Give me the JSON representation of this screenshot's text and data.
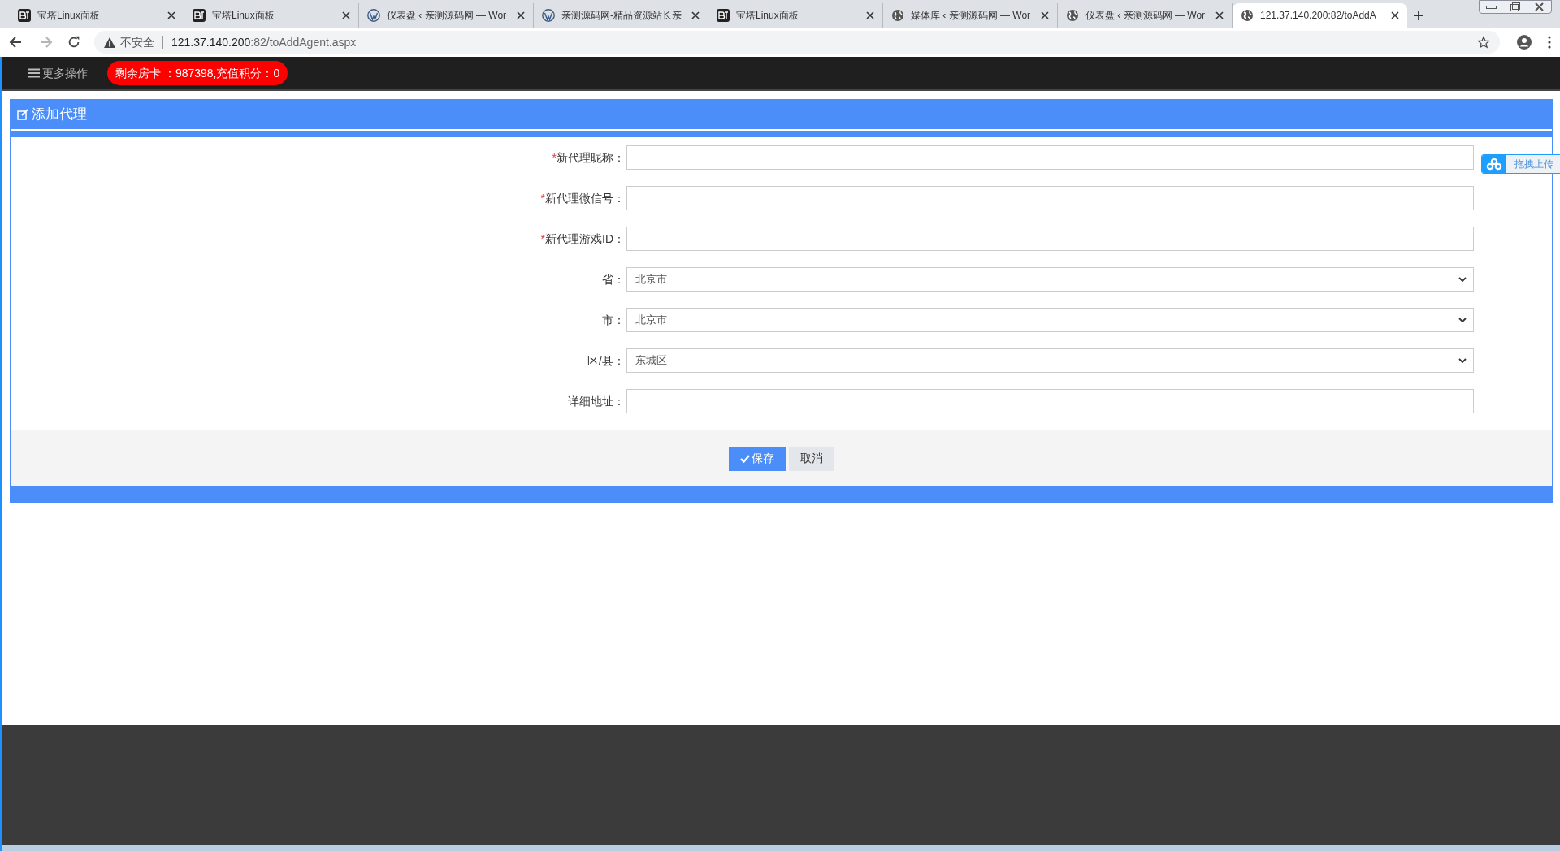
{
  "browser": {
    "tabs": [
      {
        "kind": "bt",
        "title": "宝塔Linux面板",
        "selected": false
      },
      {
        "kind": "bt",
        "title": "宝塔Linux面板",
        "selected": false
      },
      {
        "kind": "wp",
        "title": "仪表盘 ‹ 亲测源码网 — Wor",
        "selected": false
      },
      {
        "kind": "wp",
        "title": "亲测源码网-精品资源站长亲",
        "selected": false
      },
      {
        "kind": "bt",
        "title": "宝塔Linux面板",
        "selected": false
      },
      {
        "kind": "globe",
        "title": "媒体库 ‹ 亲测源码网 — Wor",
        "selected": false
      },
      {
        "kind": "globe",
        "title": "仪表盘 ‹ 亲测源码网 — Wor",
        "selected": false
      },
      {
        "kind": "globe",
        "title": "121.37.140.200:82/toAddA",
        "selected": true
      }
    ],
    "security": "不安全",
    "url_host": "121.37.140.200",
    "url_rest": ":82/toAddAgent.aspx"
  },
  "topbar": {
    "menu": "更多操作",
    "badge": "剩余房卡 ：987398,充值积分：0"
  },
  "panel": {
    "title": "添加代理",
    "fields": [
      {
        "kind": "text",
        "required_mark": "*",
        "label": "新代理昵称："
      },
      {
        "kind": "text",
        "required_mark": "*",
        "label": "新代理微信号："
      },
      {
        "kind": "text",
        "required_mark": "*",
        "label": "新代理游戏ID："
      },
      {
        "kind": "select",
        "label": "省：",
        "value": "北京市"
      },
      {
        "kind": "select",
        "label": "市：",
        "value": "北京市"
      },
      {
        "kind": "select",
        "label": "区/县：",
        "value": "东城区"
      },
      {
        "kind": "text",
        "label": "详细地址："
      }
    ],
    "save": "保存",
    "cancel": "取消"
  },
  "upload": {
    "label": "拖拽上传"
  }
}
